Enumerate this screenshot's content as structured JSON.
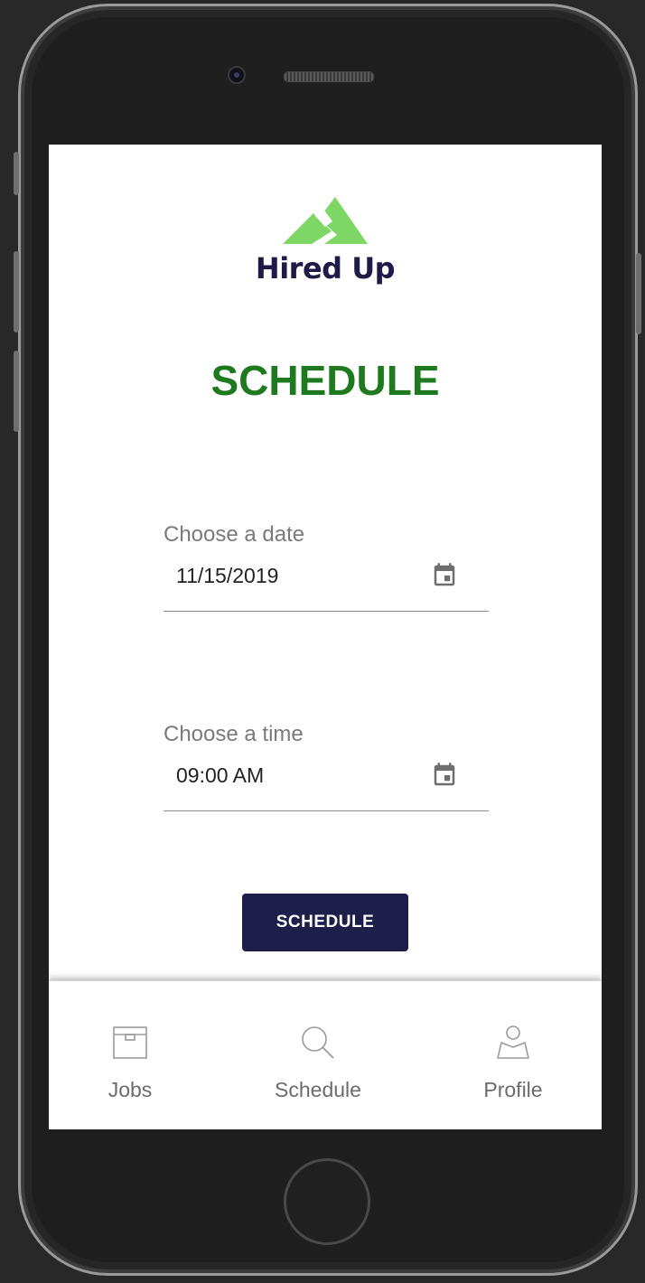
{
  "app": {
    "brand_name": "Hired Up",
    "brand_color": "#1e1c46",
    "logo_color": "#7ed665",
    "accent_green": "#1f7a1f"
  },
  "page": {
    "title": "SCHEDULE"
  },
  "form": {
    "date": {
      "label": "Choose a date",
      "value": "11/15/2019",
      "icon": "calendar-icon"
    },
    "time": {
      "label": "Choose a time",
      "value": "09:00 AM",
      "icon": "calendar-icon"
    },
    "submit_label": "SCHEDULE"
  },
  "nav": {
    "items": [
      {
        "label": "Jobs",
        "icon": "briefcase-icon"
      },
      {
        "label": "Schedule",
        "icon": "search-icon"
      },
      {
        "label": "Profile",
        "icon": "user-icon"
      }
    ]
  }
}
